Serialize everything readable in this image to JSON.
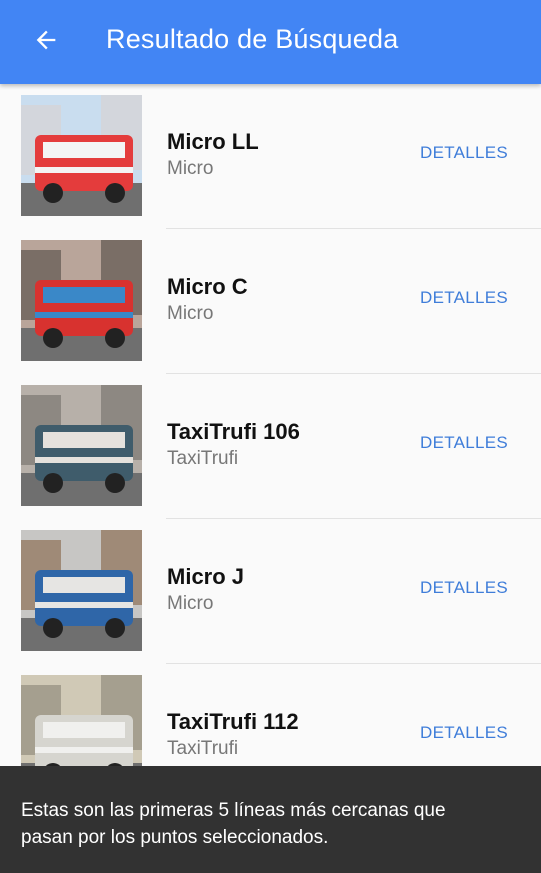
{
  "header": {
    "title": "Resultado de Búsqueda",
    "back_icon": "arrow-left-icon",
    "background": "#4285f4"
  },
  "results": [
    {
      "name": "Micro LL",
      "type": "Micro",
      "action": "DETALLES",
      "palette": [
        "#c9ddef",
        "#d3d6dc",
        "#e43c3c",
        "#f4f4f4"
      ]
    },
    {
      "name": "Micro C",
      "type": "Micro",
      "action": "DETALLES",
      "palette": [
        "#b9a59a",
        "#7a6e66",
        "#d8322f",
        "#3a88c8"
      ]
    },
    {
      "name": "TaxiTrufi 106",
      "type": "TaxiTrufi",
      "action": "DETALLES",
      "palette": [
        "#b7b0a9",
        "#8d8882",
        "#3f5c6b",
        "#e5e1dc"
      ]
    },
    {
      "name": "Micro J",
      "type": "Micro",
      "action": "DETALLES",
      "palette": [
        "#c7c6c4",
        "#9f8a77",
        "#2f66a8",
        "#e6e5e3"
      ]
    },
    {
      "name": "TaxiTrufi 112",
      "type": "TaxiTrufi",
      "action": "DETALLES",
      "palette": [
        "#d0c9b6",
        "#a59f8f",
        "#d6d5cf",
        "#f0f0ee"
      ]
    }
  ],
  "snackbar": {
    "message": "Estas son las primeras 5 líneas más cercanas que pasan por los puntos seleccionados.",
    "background": "#323232"
  },
  "colors": {
    "accent": "#3f7dd9",
    "name_text": "#111111",
    "type_text": "#777777"
  }
}
